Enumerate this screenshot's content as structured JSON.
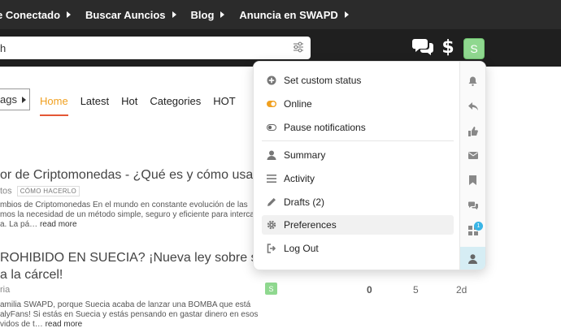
{
  "topnav": {
    "items": [
      {
        "label": "e Conectado"
      },
      {
        "label": "Buscar Auncios"
      },
      {
        "label": "Blog"
      },
      {
        "label": "Anuncia en SWAPD"
      }
    ]
  },
  "search": {
    "value": "h"
  },
  "header": {
    "avatar_letter": "S"
  },
  "list_controls": {
    "tags_label": "ags"
  },
  "tabs": [
    "Home",
    "Latest",
    "Hot",
    "Categories",
    "HOT"
  ],
  "topics": [
    {
      "title": "or de Criptomonedas - ¿Qué es y cómo usarlo?",
      "category": "tos",
      "tag": "CÓMO HACERLO",
      "excerpt": [
        "mbios de Criptomonedas En el mundo en constante evolución de las",
        "mos la necesidad de un método simple, seguro y eficiente para intercambiar",
        "a. La pá…"
      ],
      "read_more": "read more"
    },
    {
      "title_lines": [
        "ROHIBIDO EN SUECIA? ¡Nueva ley sobre sexo",
        "a la cárcel!"
      ],
      "category": "ria",
      "excerpt": [
        "amilia SWAPD, porque Suecia acaba de lanzar una BOMBA que está",
        "alyFans! Si estás en Suecia y estás pensando en gastar dinero en esos",
        "vidos de t…"
      ],
      "read_more": "read more",
      "poster_letter": "S",
      "replies": "0",
      "views": "5",
      "activity": "2d"
    }
  ],
  "user_menu": {
    "items": [
      {
        "label": "Set custom status",
        "icon": "plus-circle-icon"
      },
      {
        "label": "Online",
        "icon": "toggle-on-icon"
      },
      {
        "label": "Pause notifications",
        "icon": "toggle-off-icon"
      },
      {
        "label": "Summary",
        "icon": "user-icon"
      },
      {
        "label": "Activity",
        "icon": "list-icon"
      },
      {
        "label": "Drafts (2)",
        "icon": "pencil-icon"
      },
      {
        "label": "Preferences",
        "icon": "gear-icon"
      },
      {
        "label": "Log Out",
        "icon": "sign-out-icon"
      }
    ],
    "rail_icons": [
      "bell-icon",
      "reply-icon",
      "thumbs-up-icon",
      "envelope-icon",
      "bookmark-icon",
      "chat-icon",
      "badge-icon",
      "user-icon"
    ],
    "badge_count": "1"
  },
  "colors": {
    "topnav_bg": "#2b2b2b",
    "header_bg": "#1f1f1f",
    "active_tab": "#f0a020",
    "toggle_on": "#f0a020",
    "avatar": "#8fd88f",
    "rail_active": "#d6edf4",
    "badge": "#3ab5e6"
  }
}
